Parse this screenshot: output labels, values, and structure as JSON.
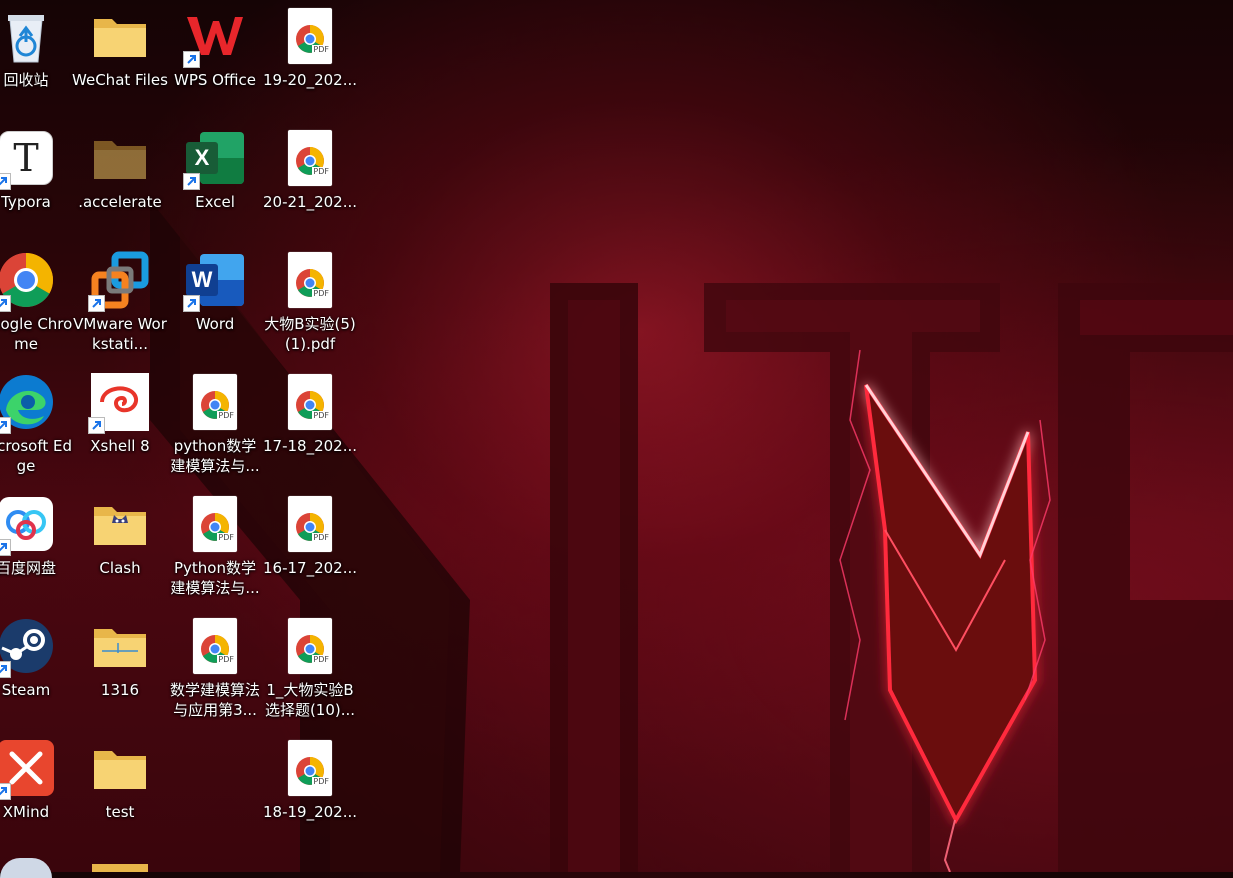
{
  "desktop": {
    "icons": [
      {
        "label": "回收站"
      },
      {
        "label": "Typora"
      },
      {
        "label": "Google Chrome"
      },
      {
        "label": "Microsoft Edge"
      },
      {
        "label": "百度网盘"
      },
      {
        "label": "Steam"
      },
      {
        "label": "XMind"
      },
      {
        "label": "WeChat Files"
      },
      {
        "label": ".accelerate"
      },
      {
        "label": "VMware Workstati..."
      },
      {
        "label": "Xshell 8"
      },
      {
        "label": "Clash"
      },
      {
        "label": "1316"
      },
      {
        "label": "test"
      },
      {
        "label": "WPS Office"
      },
      {
        "label": "Excel"
      },
      {
        "label": "Word"
      },
      {
        "label": "python数学建模算法与..."
      },
      {
        "label": "Python数学建模算法与..."
      },
      {
        "label": "数学建模算法与应用第3..."
      },
      {
        "label": "19-20_202..."
      },
      {
        "label": "20-21_202..."
      },
      {
        "label": "大物B实验(5)(1).pdf"
      },
      {
        "label": "17-18_202..."
      },
      {
        "label": "16-17_202..."
      },
      {
        "label": "1_大物实验B选择题(10)..."
      },
      {
        "label": "18-19_202..."
      }
    ],
    "pdf_badge": "PDF",
    "excel_letter": "X",
    "word_letter": "W",
    "typora_letter": "T",
    "accent_color": "#e0102a"
  }
}
